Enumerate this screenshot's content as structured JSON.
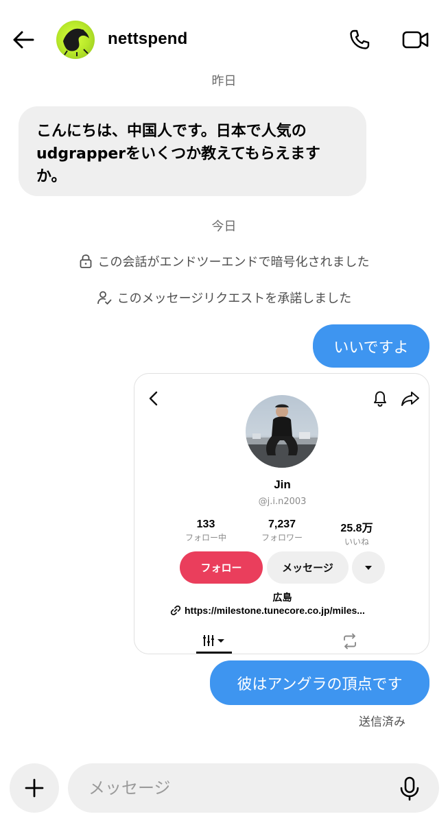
{
  "header": {
    "username": "nettspend",
    "icons": {
      "back": "arrow-left-icon",
      "call": "phone-icon",
      "video": "video-camera-icon"
    }
  },
  "thread": {
    "date_yesterday": "昨日",
    "incoming_message": "こんにちは、中国人です。日本で人気の udgrapperをいくつか教えてもらえますか。",
    "date_today": "今日",
    "system_encrypted": "この会話がエンドツーエンドで暗号化されました",
    "system_request_accepted": "このメッセージリクエストを承諾しました",
    "outgoing_1": "いいですよ",
    "outgoing_2": "彼はアングラの頂点です",
    "sent_status": "送信済み"
  },
  "shared_profile": {
    "name": "Jin",
    "handle": "@j.i.n2003",
    "stats": [
      {
        "value": "133",
        "label": "フォロー中"
      },
      {
        "value": "7,237",
        "label": "フォロワー"
      },
      {
        "value": "25.8万",
        "label": "いいね"
      }
    ],
    "follow_label": "フォロー",
    "message_label": "メッセージ",
    "location": "広島",
    "link": "https://milestone.tunecore.co.jp/miles..."
  },
  "composer": {
    "placeholder": "メッセージ"
  },
  "colors": {
    "outgoing_bubble": "#3e95f0",
    "incoming_bubble": "#efefef",
    "follow_button": "#ea3e5c"
  }
}
